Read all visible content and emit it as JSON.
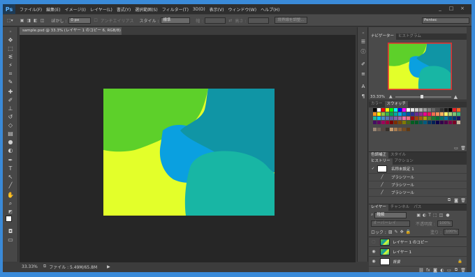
{
  "app": {
    "logo": "Ps"
  },
  "menu": [
    "ファイル(F)",
    "編集(E)",
    "イメージ(I)",
    "レイヤー(L)",
    "書式(Y)",
    "選択範囲(S)",
    "フィルター(T)",
    "3D(D)",
    "表示(V)",
    "ウィンドウ(W)",
    "ヘルプ(H)"
  ],
  "window_controls": {
    "minimize": "_",
    "restore": "□",
    "close": "×"
  },
  "options": {
    "feather_label": "ぼかし :",
    "feather_value": "0 px",
    "antialias": "アンチエイリアス",
    "style_label": "スタイル :",
    "style_value": "標準",
    "width_label": "幅 :",
    "height_label": "高さ :",
    "refine_button": "境界線を調整...",
    "workspace": "Pentec"
  },
  "document": {
    "tab_title": "sample.psd @ 33.3% (レイヤー 1 のコピー 6, RGB/8) *",
    "close": "×"
  },
  "status": {
    "zoom": "33.33%",
    "file_info": "ファイル : 5.49M/65.8M"
  },
  "navigator": {
    "tabs": [
      "ナビゲーター",
      "ヒストグラム"
    ],
    "zoom": "33.33%"
  },
  "swatches": {
    "tabs": [
      "カラー",
      "スウォッチ"
    ]
  },
  "adjust": {
    "tabs": [
      "色調補正",
      "スタイル"
    ]
  },
  "history": {
    "tabs": [
      "ヒストリー",
      "アクション"
    ],
    "items": [
      "名称未設定 1",
      "ブラシツール",
      "ブラシツール",
      "ブラシツール"
    ]
  },
  "layers": {
    "tabs": [
      "レイヤー",
      "チャンネル",
      "パス"
    ],
    "filter_kind": "種類",
    "blend_mode": "オーバーレイ",
    "opacity_label": "不透明度 :",
    "opacity_value": "100%",
    "lock_label": "ロック :",
    "fill_label": "塗り :",
    "fill_value": "100%",
    "items": [
      "レイヤー 1 のコピー",
      "レイヤー 1",
      "背景"
    ]
  },
  "colors": {
    "lime": "#5dd02a",
    "teal": "#1095a5",
    "yellow": "#e3ff2a",
    "blue": "#0aa0e0",
    "cyan": "#18b6a4"
  }
}
